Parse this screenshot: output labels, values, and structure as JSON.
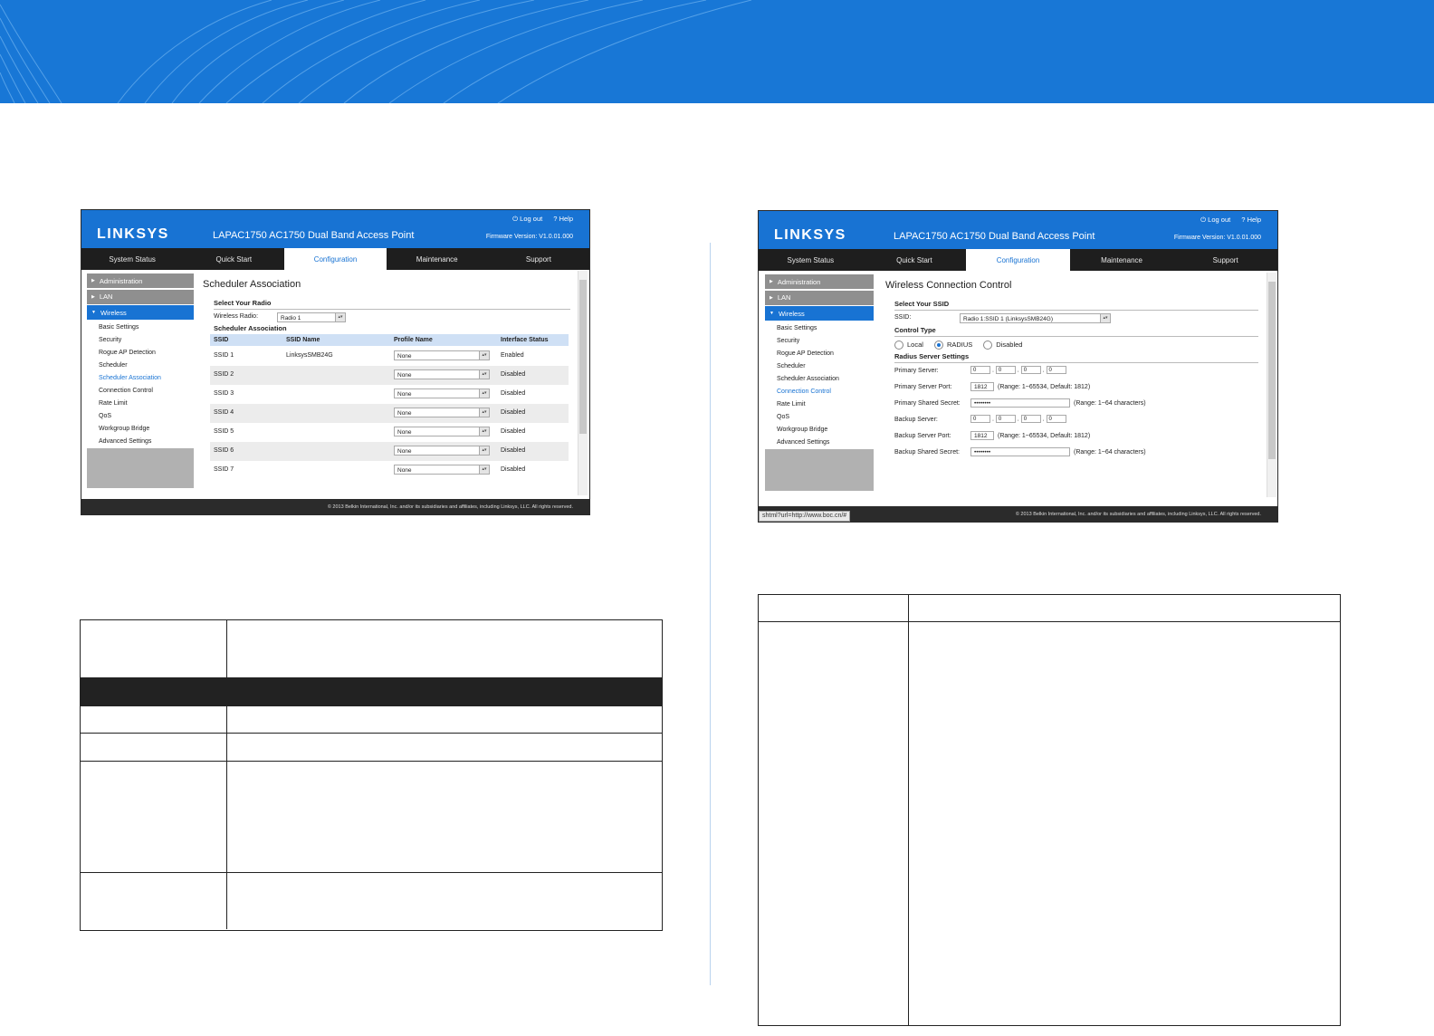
{
  "brand": "LINKSYS",
  "product_title": "LAPAC1750 AC1750 Dual Band Access Point",
  "logout_label": "Log out",
  "help_label": "Help",
  "firmware": "Firmware Version: V1.0.01.000",
  "tabs": [
    "System Status",
    "Quick Start",
    "Configuration",
    "Maintenance",
    "Support"
  ],
  "sidebar": {
    "sections": [
      "Administration",
      "LAN",
      "Wireless"
    ],
    "wireless_items": [
      "Basic Settings",
      "Security",
      "Rogue AP Detection",
      "Scheduler",
      "Scheduler Association",
      "Connection Control",
      "Rate Limit",
      "QoS",
      "Workgroup Bridge",
      "Advanced Settings"
    ]
  },
  "copyright": "© 2013 Belkin International, Inc. and/or its subsidiaries and affiliates, including Linksys, LLC. All rights reserved.",
  "left_shot": {
    "page_title": "Scheduler Association",
    "select_radio_heading": "Select Your Radio",
    "wireless_radio_label": "Wireless Radio:",
    "wireless_radio_value": "Radio 1",
    "assoc_heading": "Scheduler Association",
    "columns": [
      "SSID",
      "SSID Name",
      "Profile Name",
      "Interface Status"
    ],
    "rows": [
      {
        "ssid": "SSID 1",
        "name": "LinksysSMB24G",
        "profile": "None",
        "status": "Enabled"
      },
      {
        "ssid": "SSID 2",
        "name": "",
        "profile": "None",
        "status": "Disabled"
      },
      {
        "ssid": "SSID 3",
        "name": "",
        "profile": "None",
        "status": "Disabled"
      },
      {
        "ssid": "SSID 4",
        "name": "",
        "profile": "None",
        "status": "Disabled"
      },
      {
        "ssid": "SSID 5",
        "name": "",
        "profile": "None",
        "status": "Disabled"
      },
      {
        "ssid": "SSID 6",
        "name": "",
        "profile": "None",
        "status": "Disabled"
      },
      {
        "ssid": "SSID 7",
        "name": "",
        "profile": "None",
        "status": "Disabled"
      }
    ]
  },
  "right_shot": {
    "page_title": "Wireless Connection Control",
    "select_ssid_heading": "Select Your SSID",
    "ssid_label": "SSID:",
    "ssid_value": "Radio 1:SSID 1 (LinksysSMB24G)",
    "control_type_heading": "Control Type",
    "control_options": [
      "Local",
      "RADIUS",
      "Disabled"
    ],
    "radius_heading": "Radius Server Settings",
    "primary_server_label": "Primary Server:",
    "primary_server_ip": [
      "0",
      "0",
      "0",
      "0"
    ],
    "primary_port_label": "Primary Server Port:",
    "primary_port_value": "1812",
    "primary_port_hint": "(Range: 1~65534, Default: 1812)",
    "primary_secret_label": "Primary Shared Secret:",
    "primary_secret_value": "••••••••",
    "secret_hint": "(Range: 1~64 characters)",
    "backup_server_label": "Backup Server:",
    "backup_server_ip": [
      "0",
      "0",
      "0",
      "0"
    ],
    "backup_port_label": "Backup Server Port:",
    "backup_port_value": "1812",
    "backup_port_hint": "(Range: 1~65534, Default: 1812)",
    "backup_secret_label": "Backup Shared Secret:",
    "backup_secret_value": "••••••••",
    "status_url": "shtml?url=http://www.boc.cn/#"
  },
  "colors": {
    "brand_blue": "#1873d3",
    "banner_blue": "#1877d6",
    "tab_dark": "#1e1e1e"
  }
}
